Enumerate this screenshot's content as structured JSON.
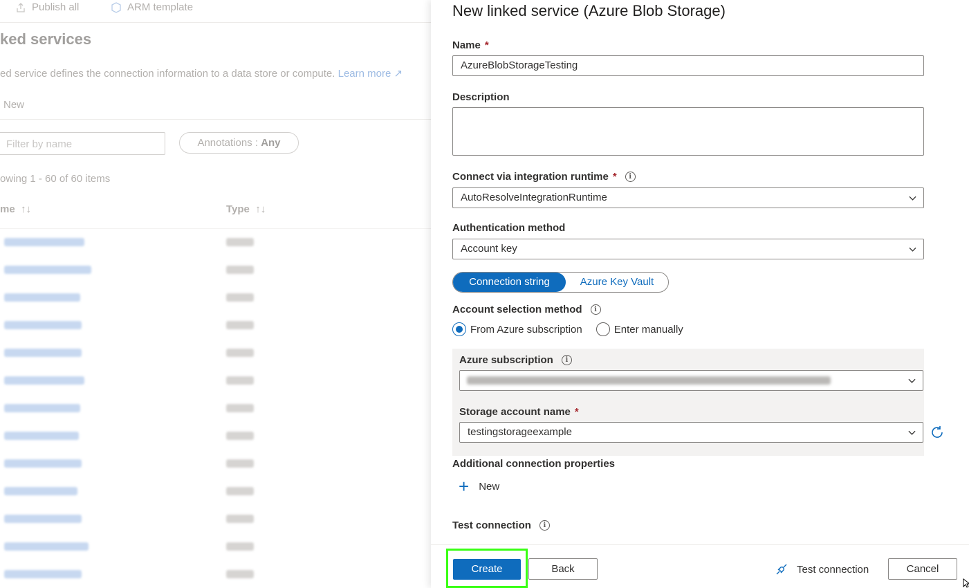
{
  "background": {
    "toolbar": {
      "publish_label": "Publish all",
      "arm_label": "ARM template"
    },
    "title": "ked services",
    "description": "ed service defines the connection information to a data store or compute.",
    "learn_more": "Learn more",
    "new_label": "New",
    "filter_placeholder": "Filter by name",
    "annotations_label": "Annotations :",
    "annotations_value": "Any",
    "items_count": "owing 1 - 60 of 60 items",
    "columns": {
      "name": "me",
      "type": "Type"
    }
  },
  "panel": {
    "title": "New linked service (Azure Blob Storage)",
    "name_label": "Name",
    "required_mark": "*",
    "name_value": "AzureBlobStorageTesting",
    "description_label": "Description",
    "description_value": "",
    "runtime_label": "Connect via integration runtime",
    "runtime_value": "AutoResolveIntegrationRuntime",
    "auth_label": "Authentication method",
    "auth_value": "Account key",
    "toggle": {
      "selected": "Connection string",
      "other": "Azure Key Vault"
    },
    "account_selection_label": "Account selection method",
    "radios": {
      "option1": "From Azure subscription",
      "option2": "Enter manually"
    },
    "subscription_label": "Azure subscription",
    "storage_label": "Storage account name",
    "storage_value": "testingstorageexample",
    "additional_label": "Additional connection properties",
    "new_prop_label": "New",
    "test_connection_label": "Test connection"
  },
  "footer": {
    "create": "Create",
    "back": "Back",
    "test_connection": "Test connection",
    "cancel": "Cancel"
  },
  "colors": {
    "accent": "#0f6cbd",
    "highlight": "#39ff14",
    "required": "#a4262c"
  }
}
